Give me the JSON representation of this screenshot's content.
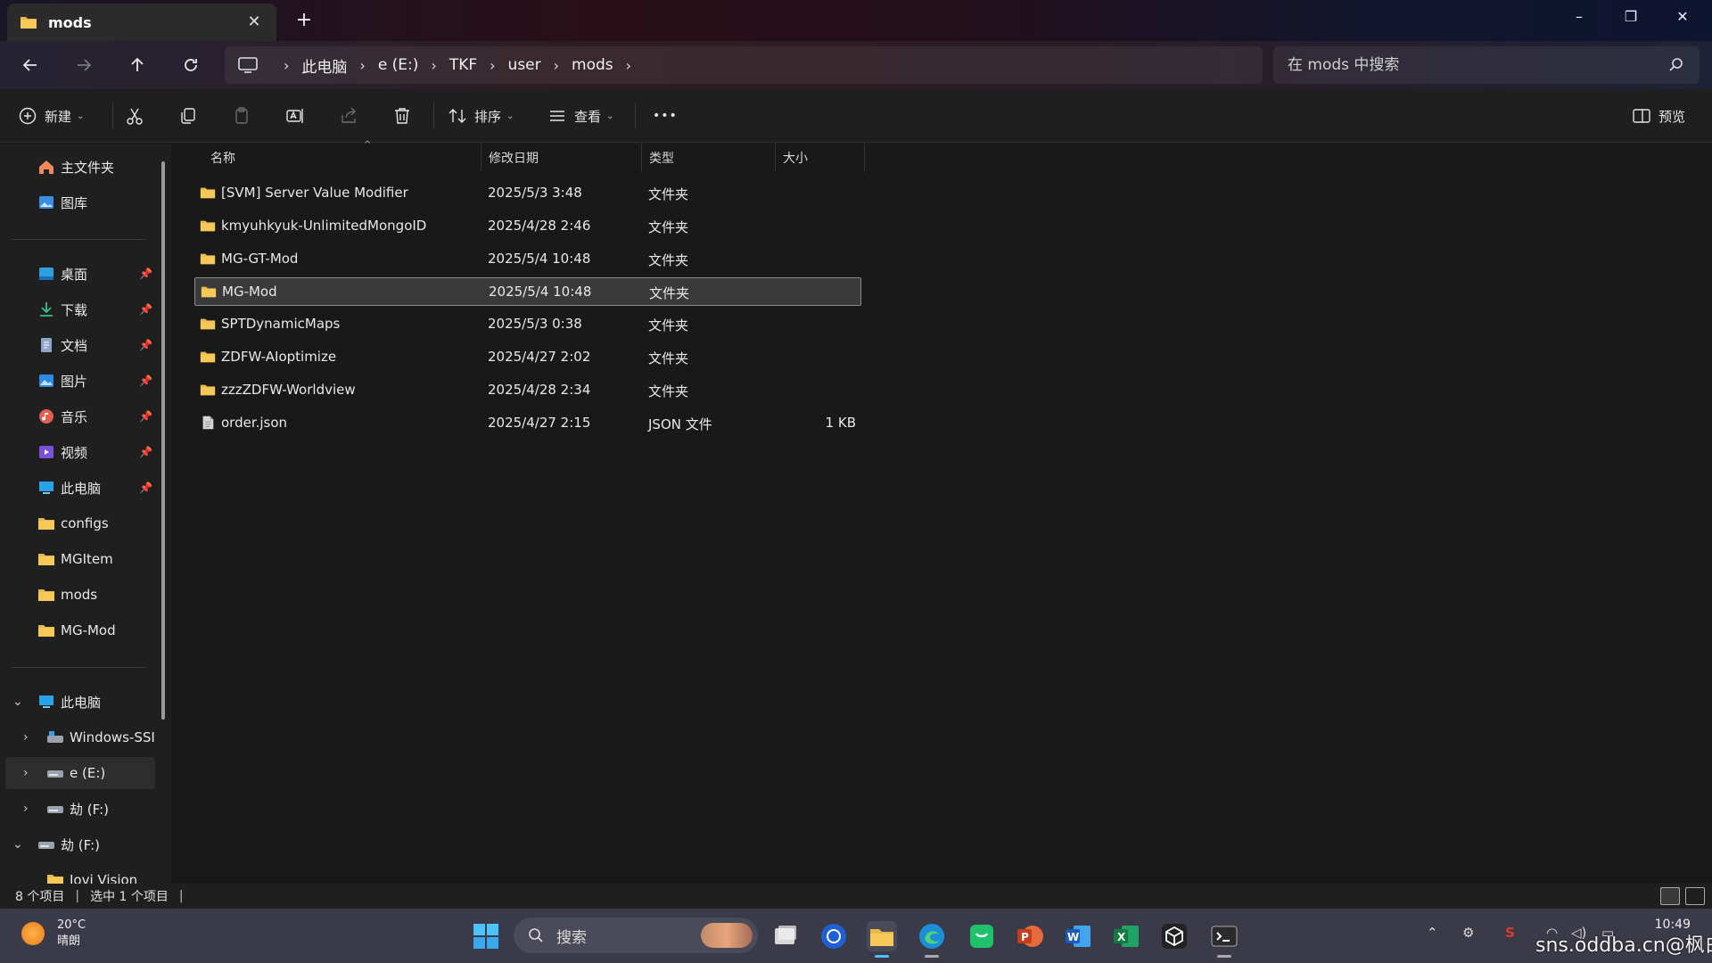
{
  "window": {
    "tab_title": "mods",
    "new_tab_label": "+",
    "minimize": "–",
    "restore": "❐",
    "close": "✕"
  },
  "navigation": {
    "breadcrumbs": [
      "此电脑",
      "e (E:)",
      "TKF",
      "user",
      "mods"
    ],
    "search_placeholder": "在 mods 中搜索"
  },
  "commands": {
    "new": "新建",
    "sort": "排序",
    "view": "查看",
    "more": "•••",
    "preview": "预览"
  },
  "sidebar": {
    "quick": [
      {
        "label": "主文件夹",
        "icon": "home-icon"
      },
      {
        "label": "图库",
        "icon": "gallery-icon"
      }
    ],
    "pinned": [
      {
        "label": "桌面",
        "icon": "desktop-icon"
      },
      {
        "label": "下载",
        "icon": "download-icon"
      },
      {
        "label": "文档",
        "icon": "document-icon"
      },
      {
        "label": "图片",
        "icon": "pictures-icon"
      },
      {
        "label": "音乐",
        "icon": "music-icon"
      },
      {
        "label": "视频",
        "icon": "video-icon"
      },
      {
        "label": "此电脑",
        "icon": "computer-icon"
      },
      {
        "label": "configs",
        "icon": "folder-icon"
      },
      {
        "label": "MGItem",
        "icon": "folder-icon"
      },
      {
        "label": "mods",
        "icon": "folder-icon"
      },
      {
        "label": "MG-Mod",
        "icon": "folder-icon"
      }
    ],
    "tree": [
      {
        "label": "此电脑",
        "expanded": true
      },
      {
        "label": "Windows-SSI",
        "expanded": false
      },
      {
        "label": "e (E:)",
        "expanded": false,
        "selected": true
      },
      {
        "label": "劫 (F:)",
        "expanded": false
      },
      {
        "label": "劫 (F:)",
        "expanded": true
      },
      {
        "label": "Iovi Vision",
        "expanded": false
      }
    ]
  },
  "columns": {
    "name": "名称",
    "date": "修改日期",
    "type": "类型",
    "size": "大小"
  },
  "files": [
    {
      "name": "[SVM] Server Value Modifier",
      "date": "2025/5/3 3:48",
      "type": "文件夹",
      "size": "",
      "kind": "folder"
    },
    {
      "name": "kmyuhkyuk-UnlimitedMongoID",
      "date": "2025/4/28 2:46",
      "type": "文件夹",
      "size": "",
      "kind": "folder"
    },
    {
      "name": "MG-GT-Mod",
      "date": "2025/5/4 10:48",
      "type": "文件夹",
      "size": "",
      "kind": "folder"
    },
    {
      "name": "MG-Mod",
      "date": "2025/5/4 10:48",
      "type": "文件夹",
      "size": "",
      "kind": "folder",
      "selected": true
    },
    {
      "name": "SPTDynamicMaps",
      "date": "2025/5/3 0:38",
      "type": "文件夹",
      "size": "",
      "kind": "folder"
    },
    {
      "name": "ZDFW-AIoptimize",
      "date": "2025/4/27 2:02",
      "type": "文件夹",
      "size": "",
      "kind": "folder"
    },
    {
      "name": "zzzZDFW-Worldview",
      "date": "2025/4/28 2:34",
      "type": "文件夹",
      "size": "",
      "kind": "folder"
    },
    {
      "name": "order.json",
      "date": "2025/4/27 2:15",
      "type": "JSON 文件",
      "size": "1 KB",
      "kind": "file"
    }
  ],
  "status": {
    "count": "8 个项目",
    "selection": "选中 1 个项目"
  },
  "taskbar": {
    "temperature": "20°C",
    "weather": "晴朗",
    "search_label": "搜索",
    "time": "10:49",
    "watermark": "sns.oddba.cn@枫白"
  },
  "colors": {
    "folder": "#e8b94a",
    "accent": "#4cc2ff"
  }
}
